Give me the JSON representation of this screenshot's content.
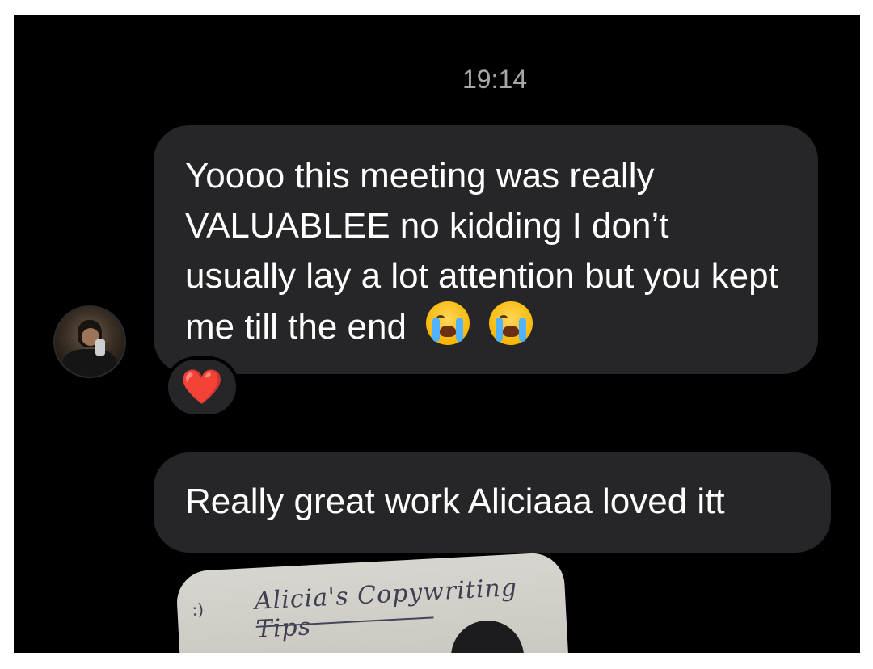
{
  "timestamp": "19:14",
  "messages": [
    {
      "text": "Yoooo this meeting was really VALUABLEE no kidding I don’t usually lay a lot attention but you kept me till the end",
      "emojis": [
        "loudly-crying-face",
        "loudly-crying-face"
      ],
      "reaction": "❤️"
    },
    {
      "text": "Really great work Aliciaaa loved itt"
    }
  ],
  "photo": {
    "title": "Alicia's Copywriting Tips",
    "doodle": ":)"
  },
  "colors": {
    "background": "#000000",
    "bubble": "#262628",
    "timestamp": "#a7a7ab",
    "heart": "#e3182d"
  }
}
